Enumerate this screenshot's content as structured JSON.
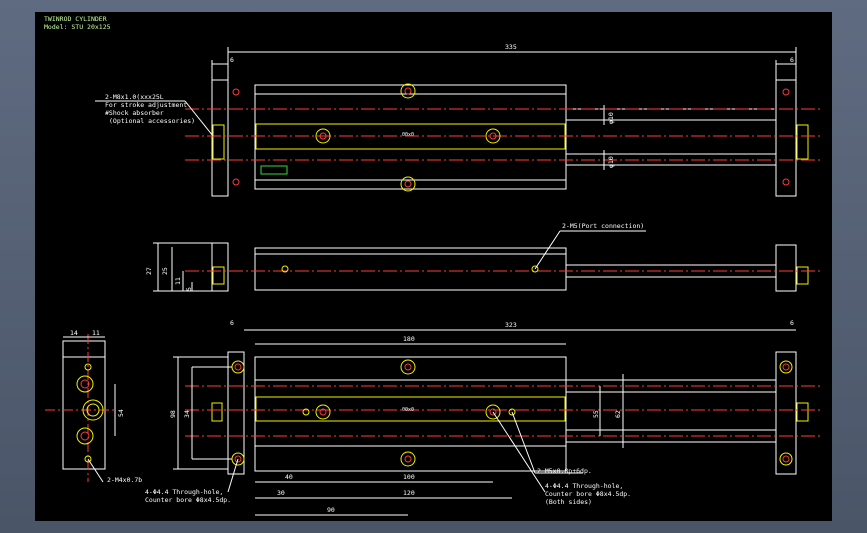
{
  "title_block": {
    "line1": "TWINROD CYLINDER",
    "line2": "Model: STU 20x125"
  },
  "top_view": {
    "overall_length": "335",
    "end_plate_left": "6",
    "end_plate_right": "6",
    "rod_dia_upper": "φ10",
    "rod_dia_lower": "φ10",
    "callout_line1": "2-M8x1.0(xxx25L",
    "callout_line2": "For stroke adjustment",
    "callout_line3": "#Shock absorber",
    "callout_line4": "(Optional accessories)",
    "center_mark": "00x0"
  },
  "side_view": {
    "height_27": "27",
    "height_25": "25",
    "height_11": "11",
    "height_5": "5",
    "port_callout": "2-M5(Port connection)"
  },
  "bottom_view": {
    "overall_length": "323",
    "end_left": "6",
    "end_right": "6",
    "body_length": "180",
    "h_98": "98",
    "h_34": "34",
    "h_55": "55",
    "h_62": "62",
    "d_40": "40",
    "d_100": "100",
    "d_30": "30",
    "d_120": "120",
    "d_90": "90",
    "tap_callout": "2-M5x0.8p+6dp.",
    "hole_callout_line1": "4-Φ4.4 Through-hole,",
    "hole_callout_line2": "Counter bore Φ8x4.5dp.",
    "hole_callout_line3": "(Both sides)",
    "left_hole_line1": "4-Φ4.4 Through-hole,",
    "left_hole_line2": "Counter bore Φ8x4.5dp.",
    "center_mark": "00x0"
  },
  "end_view": {
    "w_14": "14",
    "w_11": "11",
    "h_54": "54",
    "tap_callout": "2-M4x0.7b"
  }
}
